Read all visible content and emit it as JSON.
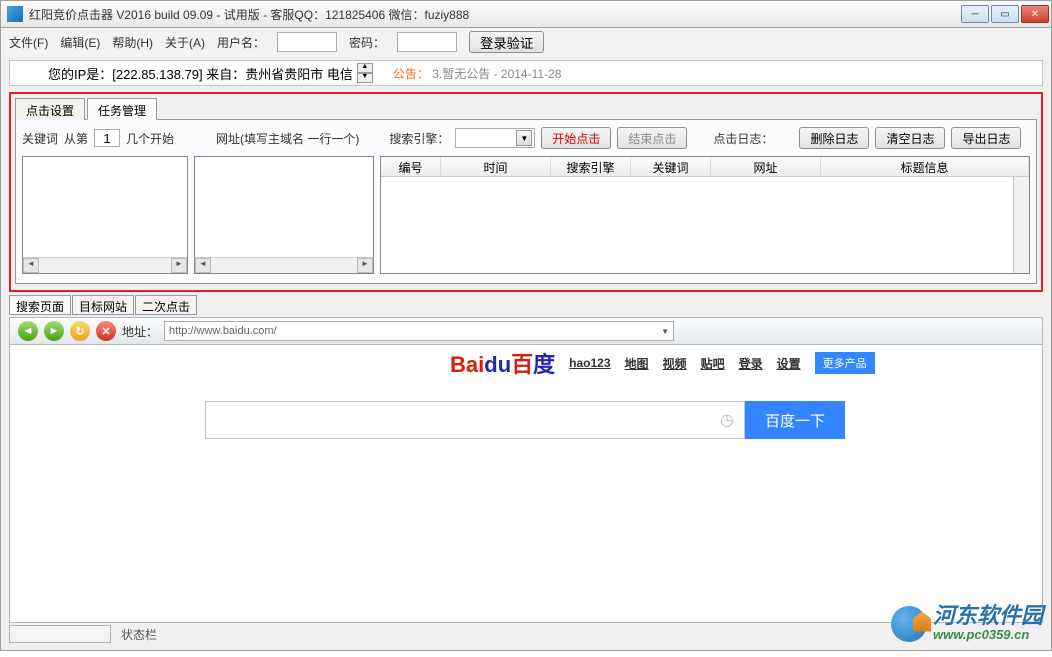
{
  "window": {
    "title": "红阳竞价点击器 V2016 build 09.09 - 试用版 - 客服QQ：121825406 微信：fuziy888"
  },
  "menu": {
    "file": "文件(F)",
    "edit": "编辑(E)",
    "help": "帮助(H)",
    "about": "关于(A)",
    "user_label": "用户名：",
    "pass_label": "密码：",
    "login_btn": "登录验证"
  },
  "ip": {
    "text": "您的IP是：[222.85.138.79] 来自：贵州省贵阳市 电信",
    "notice_label": "公告：",
    "notice_text": "3.暂无公告 - 2014-11-28"
  },
  "tabs_top": {
    "click_settings": "点击设置",
    "task_mgmt": "任务管理"
  },
  "controls": {
    "keyword_label": "关键词",
    "from_label": "从第",
    "from_value": "1",
    "start_label": "几个开始",
    "url_label": "网址(填写主域名 一行一个)",
    "search_engine_label": "搜索引擎：",
    "start_click": "开始点击",
    "stop_click": "结束点击",
    "click_log": "点击日志：",
    "delete_log": "删除日志",
    "clear_log": "清空日志",
    "export_log": "导出日志"
  },
  "grid": {
    "col_id": "编号",
    "col_time": "时间",
    "col_engine": "搜索引擎",
    "col_keyword": "关键词",
    "col_url": "网址",
    "col_title": "标题信息"
  },
  "tabs_bottom": {
    "search_page": "搜索页面",
    "target_site": "目标网站",
    "second_click": "二次点击"
  },
  "browser": {
    "addr_label": "地址：",
    "addr_value": "http://www.baidu.com/",
    "baidu_links": {
      "hao123": "hao123",
      "map": "地图",
      "video": "视频",
      "tieba": "贴吧",
      "login": "登录",
      "settings": "设置",
      "more": "更多产品"
    },
    "search_btn": "百度一下"
  },
  "status": {
    "label": "状态栏"
  },
  "watermark": {
    "name": "河东软件园",
    "url": "www.pc0359.cn"
  }
}
